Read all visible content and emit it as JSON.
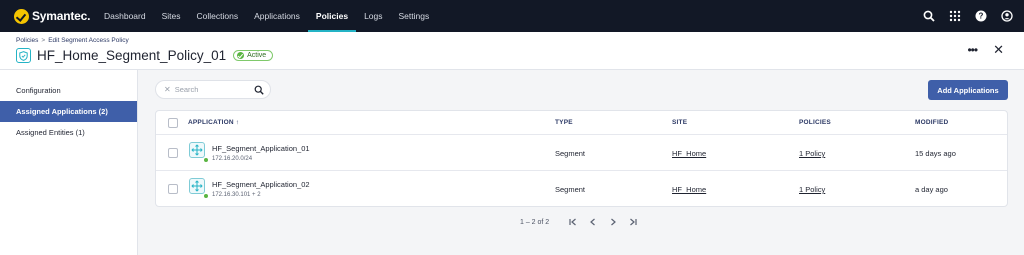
{
  "brand": {
    "name": "Symantec."
  },
  "nav": {
    "items": [
      {
        "label": "Dashboard"
      },
      {
        "label": "Sites"
      },
      {
        "label": "Collections"
      },
      {
        "label": "Applications"
      },
      {
        "label": "Policies",
        "active": true
      },
      {
        "label": "Logs"
      },
      {
        "label": "Settings"
      }
    ],
    "icons": [
      "search-icon",
      "apps-grid-icon",
      "help-icon",
      "user-icon"
    ]
  },
  "breadcrumb": {
    "root": "Policies",
    "separator": ">",
    "current": "Edit Segment Access Policy"
  },
  "page": {
    "title": "HF_Home_Segment_Policy_01",
    "status": "Active"
  },
  "sidebar": {
    "items": [
      {
        "label": "Configuration"
      },
      {
        "label": "Assigned Applications (2)",
        "active": true
      },
      {
        "label": "Assigned Entities (1)"
      }
    ]
  },
  "search": {
    "placeholder": "Search",
    "value": ""
  },
  "toolbar": {
    "add_label": "Add Applications"
  },
  "table": {
    "columns": [
      "APPLICATION ↑",
      "TYPE",
      "SITE",
      "POLICIES",
      "MODIFIED"
    ],
    "rows": [
      {
        "name": "HF_Segment_Application_01",
        "address": "172.16.20.0/24",
        "type": "Segment",
        "site": "HF_Home",
        "policies": "1 Policy",
        "modified": "15 days ago"
      },
      {
        "name": "HF_Segment_Application_02",
        "address": "172.16.30.101 + 2",
        "type": "Segment",
        "site": "HF_Home",
        "policies": "1 Policy",
        "modified": "a day ago"
      }
    ]
  },
  "pagination": {
    "range": "1 – 2 of 2"
  },
  "colors": {
    "nav_bg": "#121826",
    "accent": "#24b3c5",
    "primary": "#3f5fa9",
    "success": "#5ab542"
  }
}
